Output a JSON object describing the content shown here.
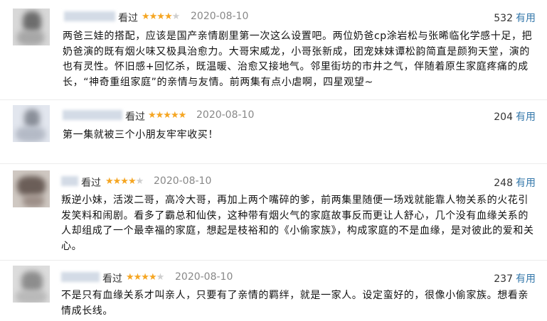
{
  "reviews": [
    {
      "seen": "看过",
      "rating": 4,
      "date": "2020-08-10",
      "votes": "532",
      "useful": "有用",
      "content": "两爸三娃的搭配，应该是国产亲情剧里第一次这么设置吧。两位奶爸cp涂岩松与张晞临化学感十足，把奶爸演的既有烟火味又极具治愈力。大哥宋威龙，小哥张新成，团宠妹妹谭松韵简直是颜狗天堂，演的也有灵性。怀旧感+回忆杀，既温暖、治愈又接地气。邻里街坊的市井之气，伴随着原生家庭疼痛的成长，“神奇重组家庭”的亲情与友情。前两集有点小虐啊，四星观望~"
    },
    {
      "seen": "看过",
      "rating": 5,
      "date": "2020-08-10",
      "votes": "204",
      "useful": "有用",
      "content": "第一集就被三个小朋友牢牢收买！"
    },
    {
      "seen": "看过",
      "rating": 4,
      "date": "2020-08-10",
      "votes": "248",
      "useful": "有用",
      "content": "叛逆小妹，活泼二哥，高冷大哥，再加上两个嘴碎的爹，前两集里随便一场戏就能靠人物关系的火花引发笑料和闹剧。看多了霸总和仙侠，这种带有烟火气的家庭故事反而更让人舒心，几个没有血缘关系的人却组成了一个最幸福的家庭，想起是枝裕和的《小偷家族》，构成家庭的不是血缘，是对彼此的爱和关心。"
    },
    {
      "seen": "看过",
      "rating": 4,
      "date": "2020-08-10",
      "votes": "237",
      "useful": "有用",
      "content": "不是只有血缘关系才叫亲人，只要有了亲情的羁绊，就是一家人。设定蛮好的，很像小偷家族。想看亲情成长线。"
    }
  ],
  "colors": {
    "star": "#f5a623",
    "link": "#3377aa",
    "date": "#888888"
  }
}
